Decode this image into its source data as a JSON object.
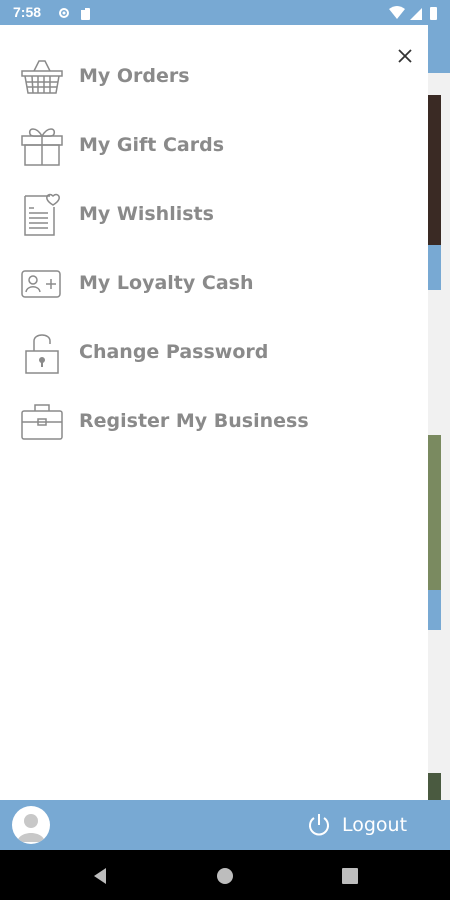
{
  "status_bar": {
    "time": "7:58"
  },
  "drawer": {
    "items": [
      {
        "label": "My Orders",
        "icon": "basket-icon"
      },
      {
        "label": "My Gift Cards",
        "icon": "gift-icon"
      },
      {
        "label": "My Wishlists",
        "icon": "wishlist-icon"
      },
      {
        "label": "My Loyalty Cash",
        "icon": "loyalty-card-icon"
      },
      {
        "label": "Change Password",
        "icon": "unlock-icon"
      },
      {
        "label": "Register My Business",
        "icon": "briefcase-icon"
      }
    ]
  },
  "bottom_bar": {
    "logout_label": "Logout"
  },
  "colors": {
    "accent": "#78a9d3",
    "menu_text": "#8a8a8a"
  }
}
